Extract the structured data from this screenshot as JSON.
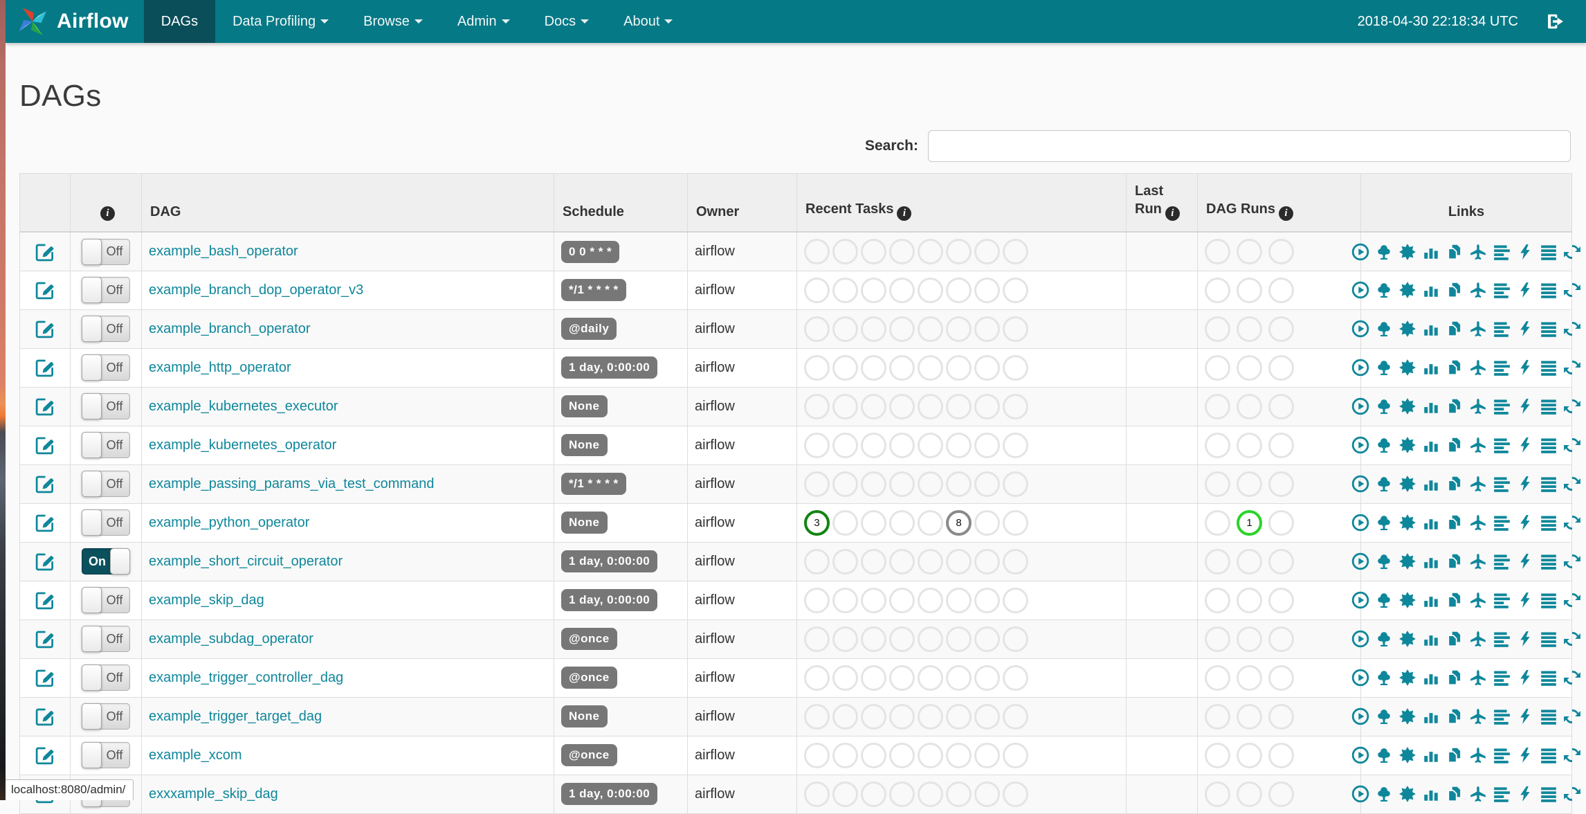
{
  "navbar": {
    "brand": "Airflow",
    "items": [
      {
        "label": "DAGs",
        "active": true,
        "caret": false
      },
      {
        "label": "Data Profiling",
        "active": false,
        "caret": true
      },
      {
        "label": "Browse",
        "active": false,
        "caret": true
      },
      {
        "label": "Admin",
        "active": false,
        "caret": true
      },
      {
        "label": "Docs",
        "active": false,
        "caret": true
      },
      {
        "label": "About",
        "active": false,
        "caret": true
      }
    ],
    "clock": "2018-04-30 22:18:34 UTC"
  },
  "page": {
    "title": "DAGs",
    "search_label": "Search:",
    "search_value": "",
    "status_bar": "localhost:8080/admin/"
  },
  "icons": {
    "info_glyph": "i"
  },
  "colors": {
    "navbar": "#067986",
    "navbar_active": "#0A4E59",
    "accent_teal": "#0F879B",
    "badge_bg": "#777777",
    "success_green": "#128412",
    "running_lime": "#2AD42A",
    "no_status_gray": "#8A8A8A",
    "empty_circle": "#E4E4E4"
  },
  "table": {
    "headers": {
      "dag": "DAG",
      "schedule": "Schedule",
      "owner": "Owner",
      "recent_tasks": "Recent Tasks",
      "last_run": "Last Run",
      "dag_runs": "DAG Runs",
      "links": "Links"
    },
    "recent_tasks_slots": 8,
    "dag_runs_slots": 3,
    "links_icons": [
      "trigger-dag",
      "tree-view",
      "graph-view",
      "task-duration",
      "task-tries",
      "landing-times",
      "gantt",
      "code",
      "details",
      "refresh"
    ],
    "rows": [
      {
        "dag": "example_bash_operator",
        "toggle": "Off",
        "schedule": "0 0 * * *",
        "owner": "airflow",
        "last_run": "",
        "recent_tasks": [],
        "dag_runs": []
      },
      {
        "dag": "example_branch_dop_operator_v3",
        "toggle": "Off",
        "schedule": "*/1 * * * *",
        "owner": "airflow",
        "last_run": "",
        "recent_tasks": [],
        "dag_runs": []
      },
      {
        "dag": "example_branch_operator",
        "toggle": "Off",
        "schedule": "@daily",
        "owner": "airflow",
        "last_run": "",
        "recent_tasks": [],
        "dag_runs": []
      },
      {
        "dag": "example_http_operator",
        "toggle": "Off",
        "schedule": "1 day, 0:00:00",
        "owner": "airflow",
        "last_run": "",
        "recent_tasks": [],
        "dag_runs": []
      },
      {
        "dag": "example_kubernetes_executor",
        "toggle": "Off",
        "schedule": "None",
        "owner": "airflow",
        "last_run": "",
        "recent_tasks": [],
        "dag_runs": []
      },
      {
        "dag": "example_kubernetes_operator",
        "toggle": "Off",
        "schedule": "None",
        "owner": "airflow",
        "last_run": "",
        "recent_tasks": [],
        "dag_runs": []
      },
      {
        "dag": "example_passing_params_via_test_command",
        "toggle": "Off",
        "schedule": "*/1 * * * *",
        "owner": "airflow",
        "last_run": "",
        "recent_tasks": [],
        "dag_runs": []
      },
      {
        "dag": "example_python_operator",
        "toggle": "Off",
        "schedule": "None",
        "owner": "airflow",
        "last_run": "",
        "recent_tasks": [
          {
            "slot": 0,
            "count": "3",
            "state": "success",
            "color": "#128412"
          },
          {
            "slot": 5,
            "count": "8",
            "state": "no-status",
            "color": "#8A8A8A"
          }
        ],
        "dag_runs": [
          {
            "slot": 1,
            "count": "1",
            "state": "running",
            "color": "#2AD42A"
          }
        ]
      },
      {
        "dag": "example_short_circuit_operator",
        "toggle": "On",
        "schedule": "1 day, 0:00:00",
        "owner": "airflow",
        "last_run": "",
        "recent_tasks": [],
        "dag_runs": []
      },
      {
        "dag": "example_skip_dag",
        "toggle": "Off",
        "schedule": "1 day, 0:00:00",
        "owner": "airflow",
        "last_run": "",
        "recent_tasks": [],
        "dag_runs": []
      },
      {
        "dag": "example_subdag_operator",
        "toggle": "Off",
        "schedule": "@once",
        "owner": "airflow",
        "last_run": "",
        "recent_tasks": [],
        "dag_runs": []
      },
      {
        "dag": "example_trigger_controller_dag",
        "toggle": "Off",
        "schedule": "@once",
        "owner": "airflow",
        "last_run": "",
        "recent_tasks": [],
        "dag_runs": []
      },
      {
        "dag": "example_trigger_target_dag",
        "toggle": "Off",
        "schedule": "None",
        "owner": "airflow",
        "last_run": "",
        "recent_tasks": [],
        "dag_runs": []
      },
      {
        "dag": "example_xcom",
        "toggle": "Off",
        "schedule": "@once",
        "owner": "airflow",
        "last_run": "",
        "recent_tasks": [],
        "dag_runs": []
      },
      {
        "dag": "exxxample_skip_dag",
        "toggle": "Off",
        "schedule": "1 day, 0:00:00",
        "owner": "airflow",
        "last_run": "",
        "recent_tasks": [],
        "dag_runs": []
      }
    ]
  }
}
